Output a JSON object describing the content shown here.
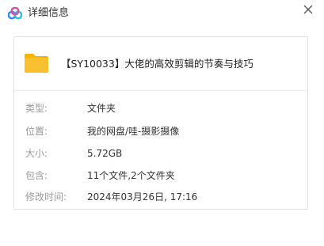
{
  "window": {
    "title": "详细信息",
    "logo_icon": "baidu-netdisk-logo-icon",
    "close_icon": "close-icon"
  },
  "file": {
    "name": "【SY10033】大佬的高效剪辑的节奏与技巧",
    "icon": "folder-icon",
    "icon_color": "#f9c12f"
  },
  "details": [
    {
      "label": "类型:",
      "value": "文件夹"
    },
    {
      "label": "位置:",
      "value": "我的网盘/哇-摄影摄像"
    },
    {
      "label": "大小:",
      "value": "5.72GB"
    },
    {
      "label": "包含:",
      "value": "11个文件,2个文件夹"
    },
    {
      "label": "修改时间:",
      "value": "2024年03月26日, 17:16"
    }
  ]
}
